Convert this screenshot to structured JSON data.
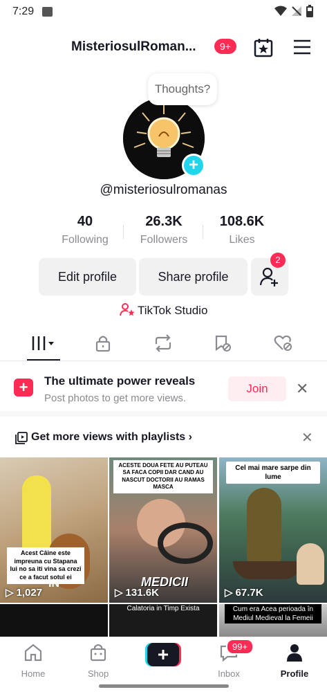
{
  "status_bar": {
    "time": "7:29"
  },
  "header": {
    "username": "MisteriosulRoman...",
    "notification_badge": "9+"
  },
  "profile": {
    "thought_bubble": "Thoughts?",
    "handle": "@misteriosulromanas",
    "stats": [
      {
        "value": "40",
        "label": "Following"
      },
      {
        "value": "26.3K",
        "label": "Followers"
      },
      {
        "value": "108.6K",
        "label": "Likes"
      }
    ],
    "edit_button": "Edit profile",
    "share_button": "Share profile",
    "friends_badge": "2",
    "studio_link": "TikTok Studio"
  },
  "promo": {
    "title": "The ultimate power reveals",
    "subtitle": "Post photos to get more views.",
    "join_label": "Join"
  },
  "playlists": {
    "label": "Get more views with playlists"
  },
  "videos": [
    {
      "views": "1,027",
      "caption": "Acest  Câine este impreuna cu Stapana lui no sa iti vina sa crezi ce a facut sotul ei",
      "overlay": "IN"
    },
    {
      "views": "131.6K",
      "caption": "ACESTE DOUA FETE AU PUTEAU SA FACA COPII DAR CAND AU NASCUT DOCTORII  AU RAMAS MASCA",
      "overlay": "MEDICII"
    },
    {
      "views": "67.7K",
      "caption": "Cel mai mare sarpe din lume"
    },
    {
      "caption": ""
    },
    {
      "caption": "Calatoria in Timp Exista"
    },
    {
      "caption": "Cum era Acea perioada în Mediul Medieval la Femeii"
    }
  ],
  "bottom_nav": [
    {
      "label": "Home"
    },
    {
      "label": "Shop"
    },
    {
      "label": "Inbox",
      "badge": "99+"
    },
    {
      "label": "Profile"
    }
  ],
  "colors": {
    "accent": "#fe2c55",
    "cyan": "#20d5ec",
    "text": "#161823",
    "muted": "#8a8b91"
  }
}
